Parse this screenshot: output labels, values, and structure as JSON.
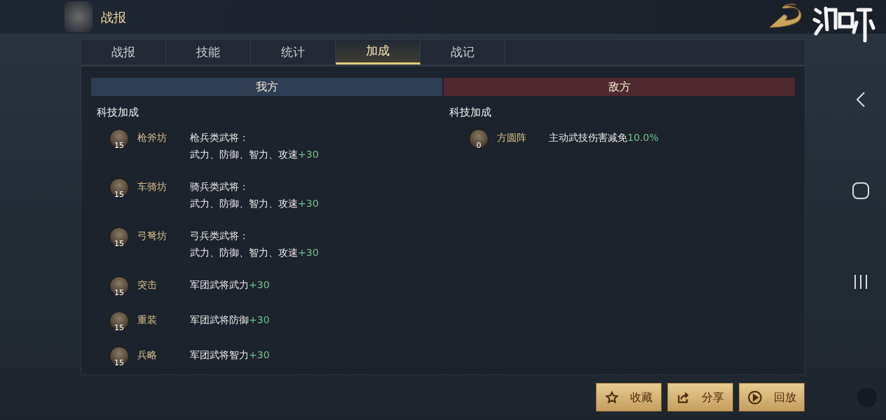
{
  "header": {
    "title": "战报"
  },
  "tabs": [
    {
      "label": "战报",
      "selected": false
    },
    {
      "label": "技能",
      "selected": false
    },
    {
      "label": "统计",
      "selected": false
    },
    {
      "label": "加成",
      "selected": true
    },
    {
      "label": "战记",
      "selected": false
    }
  ],
  "sides": [
    {
      "kind": "ally",
      "title": "我方",
      "section": "科技加成",
      "items": [
        {
          "name": "枪斧坊",
          "level": "15",
          "lines": [
            "枪兵类武将：",
            "武力、防御、智力、攻速"
          ],
          "bonus": "+30"
        },
        {
          "name": "车骑坊",
          "level": "15",
          "lines": [
            "骑兵类武将：",
            "武力、防御、智力、攻速"
          ],
          "bonus": "+30"
        },
        {
          "name": "弓弩坊",
          "level": "15",
          "lines": [
            "弓兵类武将：",
            "武力、防御、智力、攻速"
          ],
          "bonus": "+30"
        },
        {
          "name": "突击",
          "level": "15",
          "lines": [
            "军团武将武力"
          ],
          "bonus": "+30"
        },
        {
          "name": "重装",
          "level": "15",
          "lines": [
            "军团武将防御"
          ],
          "bonus": "+30"
        },
        {
          "name": "兵略",
          "level": "15",
          "lines": [
            "军团武将智力"
          ],
          "bonus": "+30"
        }
      ]
    },
    {
      "kind": "enemy",
      "title": "敌方",
      "section": "科技加成",
      "items": [
        {
          "name": "方圆阵",
          "level": "0",
          "lines": [
            "主动武技伤害减免"
          ],
          "bonus": "10.0%"
        }
      ]
    }
  ],
  "buttons": [
    {
      "kind": "star",
      "label": "收藏"
    },
    {
      "kind": "share",
      "label": "分享"
    },
    {
      "kind": "play",
      "label": "回放"
    }
  ]
}
